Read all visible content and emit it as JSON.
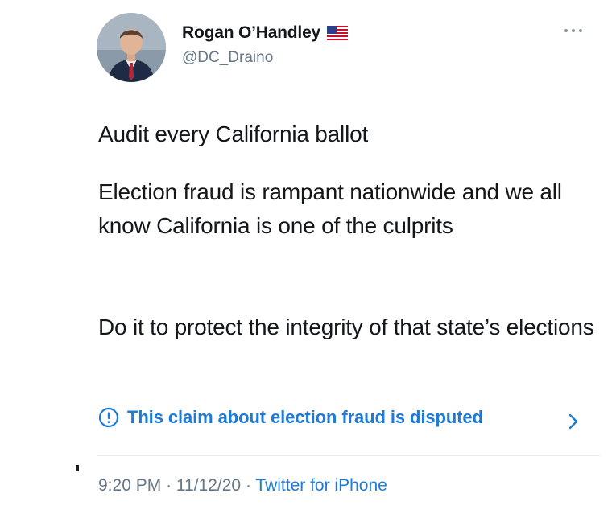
{
  "author": {
    "name": "Rogan O’Handley",
    "handle": "@DC_Draino",
    "flag_icon": "us-flag-icon",
    "avatar_icon": "profile-photo"
  },
  "more_menu_icon": "ellipsis-icon",
  "tweet": {
    "paragraph_1": "Audit every California ballot",
    "paragraph_2": "Election fraud is rampant nationwide and we all know California is one of the culprits",
    "paragraph_3": "Do it to protect the integrity of that state’s elections"
  },
  "dispute_notice": {
    "text": "This claim about election fraud is disputed",
    "icon": "info-icon",
    "chevron": "chevron-right-icon"
  },
  "meta": {
    "time": "9:20 PM",
    "separator": "·",
    "date": "11/12/20",
    "source": "Twitter for iPhone"
  },
  "colors": {
    "link_blue": "#1d7bd4",
    "secondary_gray": "#657786",
    "text_dark": "#14171a"
  }
}
